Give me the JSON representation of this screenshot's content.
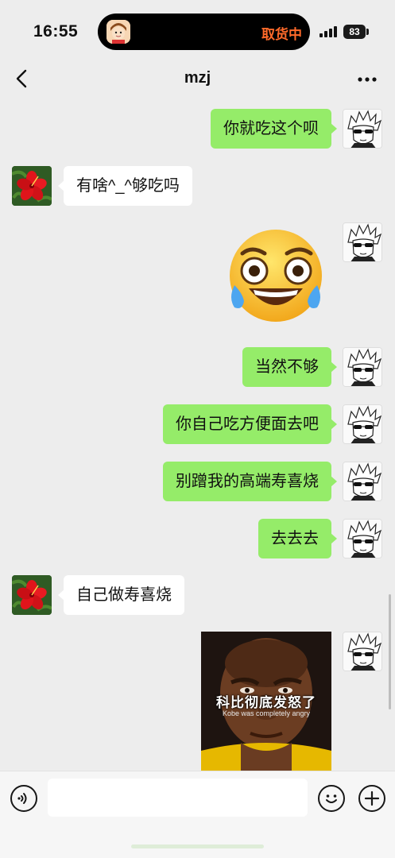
{
  "status_bar": {
    "time": "16:55",
    "island_text": "取货中",
    "battery": "83"
  },
  "nav": {
    "title": "mzj",
    "back_icon": "chevron-left-icon",
    "more_icon": "more-dots-icon"
  },
  "messages": [
    {
      "from": "me",
      "text": "你就吃这个呗"
    },
    {
      "from": "them",
      "text": "有啥^_^够吃吗"
    },
    {
      "from": "me",
      "type": "sticker",
      "icon": "laughing-crying-emoji"
    },
    {
      "from": "me",
      "text": "当然不够"
    },
    {
      "from": "me",
      "text": "你自己吃方便面去吧"
    },
    {
      "from": "me",
      "text": "别蹭我的高端寿喜烧"
    },
    {
      "from": "me",
      "text": "去去去"
    },
    {
      "from": "them",
      "text": "自己做寿喜烧"
    },
    {
      "from": "me",
      "type": "image",
      "caption_cn": "科比彻底发怒了",
      "caption_en": "Kobe was completely angry"
    }
  ],
  "input_bar": {
    "voice_icon": "voice-icon",
    "input_value": "",
    "emoji_icon": "emoji-icon",
    "plus_icon": "plus-icon"
  },
  "colors": {
    "background": "#ededed",
    "my_bubble": "#95ec69",
    "their_bubble": "#ffffff",
    "island_text": "#ff6a2a"
  }
}
